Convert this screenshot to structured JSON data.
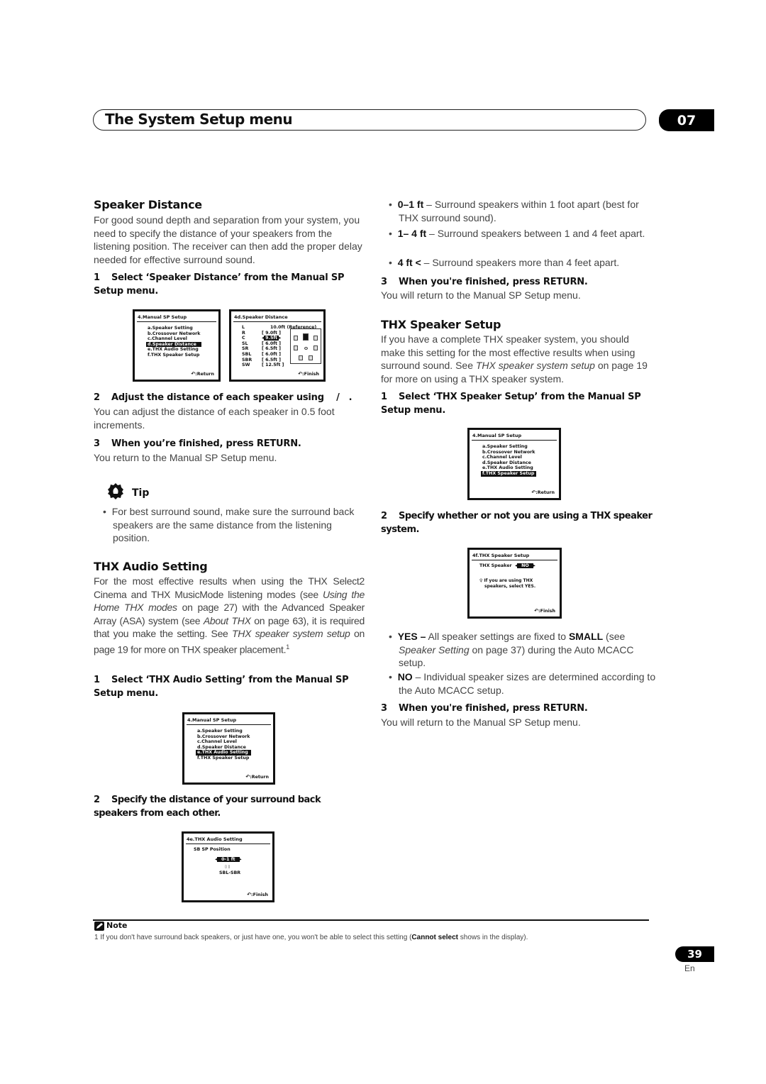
{
  "header": {
    "title": "The System Setup menu",
    "chapter": "07"
  },
  "left": {
    "speaker_distance": {
      "heading": "Speaker Distance",
      "intro": "For good sound depth and separation from your system, you need to specify the distance of your speakers from the listening position. The receiver can then add the proper delay needed for effective surround sound.",
      "step1": {
        "num": "1",
        "text": "Select ‘Speaker Distance’ from the Manual SP Setup menu."
      },
      "step2": {
        "num": "2",
        "text": "Adjust the distance of each speaker using    /   .",
        "body": "You can adjust the distance of each speaker in 0.5 foot increments."
      },
      "step3": {
        "num": "3",
        "text": "When you’re finished, press RETURN.",
        "body": "You return to the Manual SP Setup menu."
      },
      "tip": {
        "label": "Tip",
        "bullet": "For best surround sound, make sure the surround back speakers are the same distance from the listening position."
      }
    },
    "thx_audio": {
      "heading": "THX Audio Setting",
      "intro_a": "For the most effective results when using the THX Select2 Cinema and THX MusicMode listening modes (see ",
      "intro_i1": "Using the Home THX modes",
      "intro_b": " on page 27) with the Advanced Speaker Array (ASA) system (see ",
      "intro_i2": "About THX",
      "intro_c": " on page 63), it is required that you make the setting. See ",
      "intro_i3": "THX speaker system setup",
      "intro_d": " on page 19 for more on THX speaker placement.",
      "footnote_ref": "1",
      "step1": {
        "num": "1",
        "text": "Select ‘THX Audio Setting’ from the Manual SP Setup menu."
      },
      "step2": {
        "num": "2",
        "text": "Specify the distance of your surround back speakers from each other."
      }
    }
  },
  "right": {
    "bullets": [
      {
        "bold": "0–1 ft",
        "text": " – Surround speakers within 1 foot apart (best for THX surround sound)."
      },
      {
        "bold": "1– 4 ft",
        "text": " – Surround speakers between 1 and 4 feet apart."
      },
      {
        "bold": "4 ft <",
        "text": " – Surround speakers more than 4 feet apart."
      }
    ],
    "step3": {
      "num": "3",
      "text": "When you're finished, press RETURN.",
      "body": "You will return to the Manual SP Setup menu."
    },
    "thx_speaker": {
      "heading": "THX Speaker Setup",
      "intro_a": "If you have a complete THX speaker system, you should make this setting for the most effective results when using surround sound. See ",
      "intro_i": "THX speaker system setup",
      "intro_b": " on page 19 for more on using a THX speaker system.",
      "step1": {
        "num": "1",
        "text": "Select ‘THX Speaker Setup’ from the Manual SP Setup menu."
      },
      "step2": {
        "num": "2",
        "text": "Specify whether or not you are using a THX speaker system."
      },
      "yes": {
        "bold": "YES –",
        "a": " All speaker settings are fixed to ",
        "b2": "SMALL",
        "c": " (see ",
        "i": "Speaker Setting",
        "d": " on page 37) during the Auto MCACC setup."
      },
      "no": {
        "bold": "NO",
        "text": " – Individual speaker sizes are determined according to the Auto MCACC setup."
      },
      "step3": {
        "num": "3",
        "text": "When you're finished, press RETURN.",
        "body": "You will return to the Manual SP Setup menu."
      }
    }
  },
  "osd": {
    "manual_menu": {
      "title": "4.Manual  SP  Setup",
      "items": [
        "a.Speaker  Setting",
        "b.Crossover  Network",
        "c.Channel  Level",
        "d.Speaker  Distance",
        "e.THX  Audio  Setting",
        "f.THX  Speaker  Setup"
      ],
      "footer": ":Return"
    },
    "distance": {
      "title": "4d.Speaker  Distance",
      "rows": [
        {
          "ch": "L",
          "val": "10.0ft (Reference)"
        },
        {
          "ch": "R",
          "val": "[  9.0ft ]"
        },
        {
          "ch": "C",
          "val": "9.5ft"
        },
        {
          "ch": "SL",
          "val": "[  6.0ft ]"
        },
        {
          "ch": "SR",
          "val": "[  6.5ft ]"
        },
        {
          "ch": "SBL",
          "val": "[  6.0ft ]"
        },
        {
          "ch": "SBR",
          "val": "[  6.5ft ]"
        },
        {
          "ch": "SW",
          "val": "[ 12.5ft ]"
        }
      ],
      "footer": ":Finish"
    },
    "thx_audio": {
      "title": "4e.THX  Audio  Setting",
      "label": "SB  SP  Position",
      "value": "0-1  ft",
      "pair": "SBL-SBR",
      "footer": ":Finish"
    },
    "thx_speaker": {
      "title": "4f.THX Speaker Setup",
      "label": "THX Speaker",
      "value": "NO",
      "hint1": "If you are using THX",
      "hint2": "speakers, select YES.",
      "footer": ":Finish"
    }
  },
  "note": {
    "label": "Note",
    "text_a": "1 If you don't have surround back speakers, or just have one, you won't be able to select this setting (",
    "bold": "Cannot select",
    "text_b": " shows in the display)."
  },
  "footer": {
    "page": "39",
    "lang": "En"
  }
}
